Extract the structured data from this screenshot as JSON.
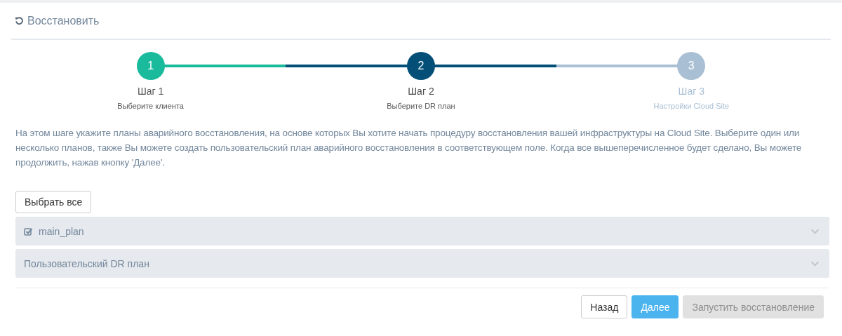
{
  "header": {
    "title": "Восстановить"
  },
  "steps": [
    {
      "number": "1",
      "title": "Шаг 1",
      "subtitle": "Выберите клиента",
      "completed": true,
      "selected": false
    },
    {
      "number": "2",
      "title": "Шаг 2",
      "subtitle": "Выберите DR план",
      "completed": false,
      "selected": true
    },
    {
      "number": "3",
      "title": "Шаг 3",
      "subtitle": "Настройки Cloud Site",
      "completed": false,
      "selected": false
    }
  ],
  "description": "На этом шаге укажите планы аварийного восстановления, на основе которых Вы хотите начать процедуру восстановления вашей инфраструктуры на Cloud Site. Выберите один или несколько планов, также Вы можете создать пользовательский план аварийного восстановления в соответствующем поле. Когда все вышеперечисленное будет сделано, Вы можете продолжить, нажав кнопку 'Далее'.",
  "select_all_button": "Выбрать все",
  "plans": [
    {
      "name": "main_plan",
      "checked": true,
      "expanded": false
    },
    {
      "name": "Пользовательский DR план",
      "checked": false,
      "expanded": false
    }
  ],
  "buttons": [
    {
      "label": "Назад",
      "kind": "default"
    },
    {
      "label": "Далее",
      "kind": "primary"
    },
    {
      "label": "Запустить восстановление",
      "kind": "disabled"
    }
  ]
}
